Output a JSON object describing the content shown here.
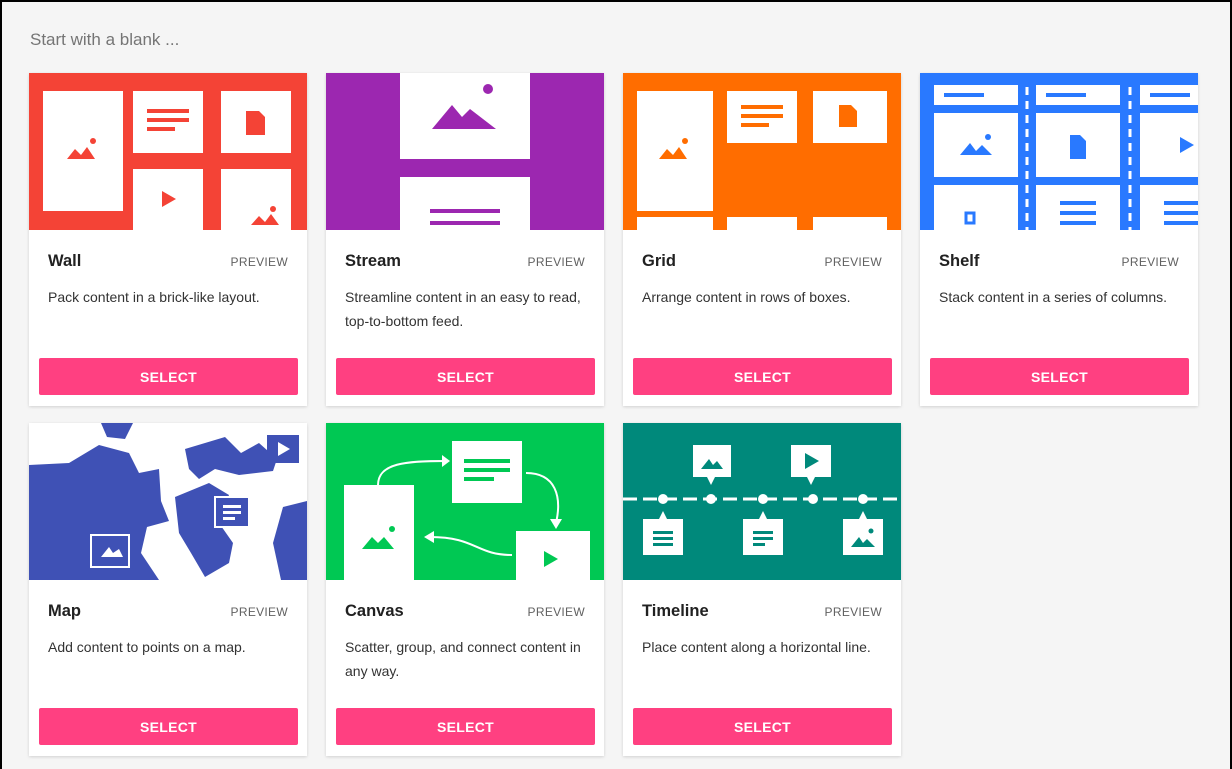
{
  "heading": "Start with a blank ...",
  "preview_label": "PREVIEW",
  "select_label": "SELECT",
  "layouts": [
    {
      "title": "Wall",
      "description": "Pack content in a brick-like layout.",
      "color": "#f44336",
      "icon": "wall-illustration"
    },
    {
      "title": "Stream",
      "description": "Streamline content in an easy to read, top-to-bottom feed.",
      "color": "#9c27b0",
      "icon": "stream-illustration"
    },
    {
      "title": "Grid",
      "description": "Arrange content in rows of boxes.",
      "color": "#ff6d00",
      "icon": "grid-illustration"
    },
    {
      "title": "Shelf",
      "description": "Stack content in a series of columns.",
      "color": "#2979ff",
      "icon": "shelf-illustration"
    },
    {
      "title": "Map",
      "description": "Add content to points on a map.",
      "color": "#3f51b5",
      "icon": "map-illustration"
    },
    {
      "title": "Canvas",
      "description": "Scatter, group, and connect content in any way.",
      "color": "#00c853",
      "icon": "canvas-illustration"
    },
    {
      "title": "Timeline",
      "description": "Place content along a horizontal line.",
      "color": "#00897b",
      "icon": "timeline-illustration"
    }
  ],
  "accent_color": "#ff4081"
}
